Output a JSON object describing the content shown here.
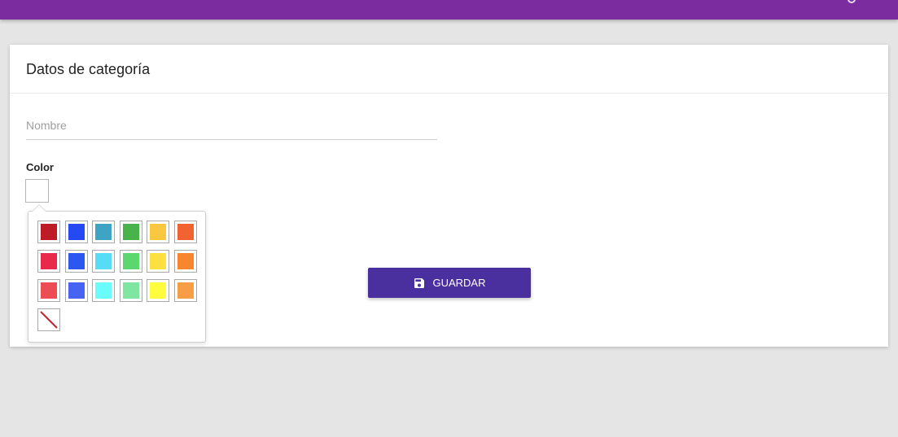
{
  "form": {
    "title": "Datos de categoría",
    "name_placeholder": "Nombre",
    "name_value": "",
    "color_label": "Color",
    "selected_color": "#ffffff",
    "save_label": "GUARDAR"
  },
  "theme": {
    "topbar": "#7b2c9f",
    "save_button": "#4a2f9e"
  },
  "palette": {
    "swatches": [
      [
        "#bd1c26",
        "#2549f2",
        "#3fa3c4",
        "#47b34a",
        "#f9c840",
        "#f26332"
      ],
      [
        "#e8294a",
        "#2c57f0",
        "#56dcf5",
        "#5bd76d",
        "#fbe040",
        "#f7862f"
      ],
      [
        "#ec4d55",
        "#4663f1",
        "#6afcfd",
        "#7ee6a0",
        "#fefc3d",
        "#f79d46"
      ]
    ],
    "none_icon": "no-color-icon"
  },
  "icons": {
    "save": "floppy-disk-icon"
  }
}
